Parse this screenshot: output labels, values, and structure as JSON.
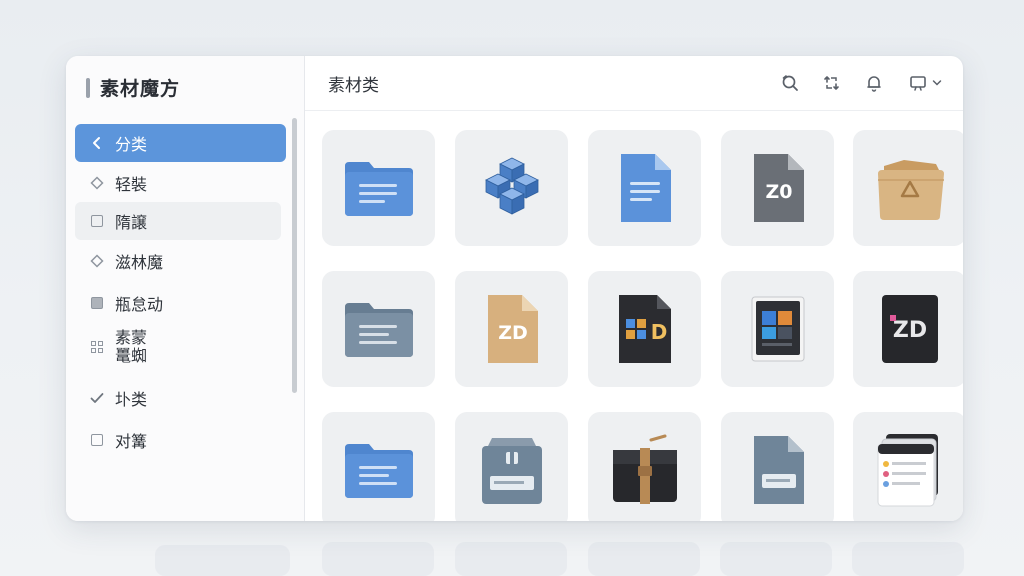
{
  "app": {
    "title": "素材魔方"
  },
  "sidebar": {
    "items": [
      {
        "label": "分类",
        "icon": "chevron-left-icon",
        "state": "active"
      },
      {
        "label": "轻裝",
        "icon": "diamond-icon"
      },
      {
        "label": "隋譲",
        "icon": "square-icon",
        "state": "hover"
      },
      {
        "label": "滋林魔",
        "icon": "diamond-icon"
      },
      {
        "label": "瓶怠动",
        "icon": "filled-square-icon"
      },
      {
        "label": "素蒙\n鼍蜘",
        "icon": "grid-icon"
      },
      {
        "label": "圤类",
        "icon": "check-icon"
      },
      {
        "label": "对篝",
        "icon": "square-icon"
      }
    ]
  },
  "header": {
    "breadcrumb": "素材类",
    "icons": [
      "search-refresh-icon",
      "sync-icon",
      "bell-icon",
      "display-icon",
      "chevron-down-icon"
    ]
  },
  "tiles": [
    {
      "kind": "blue-folder-doc"
    },
    {
      "kind": "blue-cubes"
    },
    {
      "kind": "blue-document"
    },
    {
      "kind": "gray-file",
      "text": "Z0"
    },
    {
      "kind": "brown-folder"
    },
    {
      "kind": "slate-folder-doc"
    },
    {
      "kind": "tan-file",
      "text": "ZD"
    },
    {
      "kind": "dark-file",
      "text": "D"
    },
    {
      "kind": "dark-media-file"
    },
    {
      "kind": "dark-card",
      "text": "ZD"
    },
    {
      "kind": "blue-folder-doc"
    },
    {
      "kind": "slate-gift-file"
    },
    {
      "kind": "black-bag"
    },
    {
      "kind": "slate-doc-badge"
    },
    {
      "kind": "card-stack"
    }
  ],
  "colors": {
    "accent": "#5c95db",
    "folder_blue": "#5a8fd6",
    "slate": "#6f8599",
    "tan": "#d7b07e",
    "dark": "#2b2c30"
  }
}
